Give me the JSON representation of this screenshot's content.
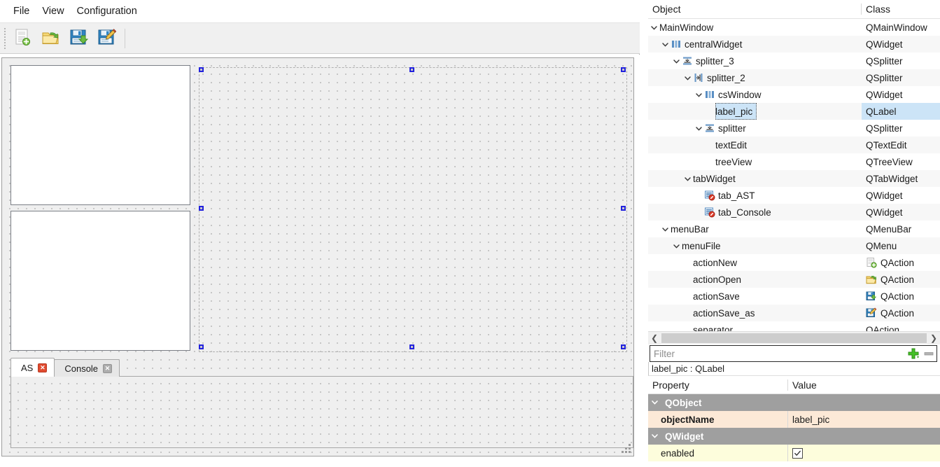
{
  "menubar": {
    "items": [
      {
        "label": "File"
      },
      {
        "label": "View"
      },
      {
        "label": "Configuration"
      }
    ]
  },
  "toolbar": {
    "buttons": [
      {
        "name": "new-file-icon",
        "tooltip": "New"
      },
      {
        "name": "open-folder-icon",
        "tooltip": "Open"
      },
      {
        "name": "save-icon",
        "tooltip": "Save"
      },
      {
        "name": "save-as-icon",
        "tooltip": "Save as"
      }
    ]
  },
  "designer": {
    "tabs": [
      {
        "label": "AS",
        "active": true,
        "close_style": "red"
      },
      {
        "label": "Console",
        "active": false,
        "close_style": "grey"
      }
    ]
  },
  "object_tree": {
    "columns": {
      "object": "Object",
      "class": "Class"
    },
    "rows": [
      {
        "indent": 0,
        "arrow": "down",
        "icon": "none",
        "name": "MainWindow",
        "class": "QMainWindow",
        "class_icon": "none",
        "selected": false
      },
      {
        "indent": 1,
        "arrow": "down",
        "icon": "widget",
        "name": "centralWidget",
        "class": "QWidget",
        "class_icon": "none",
        "selected": false
      },
      {
        "indent": 2,
        "arrow": "down",
        "icon": "vsplit",
        "name": "splitter_3",
        "class": "QSplitter",
        "class_icon": "none",
        "selected": false
      },
      {
        "indent": 3,
        "arrow": "down",
        "icon": "hsplit",
        "name": "splitter_2",
        "class": "QSplitter",
        "class_icon": "none",
        "selected": false
      },
      {
        "indent": 4,
        "arrow": "down",
        "icon": "widget",
        "name": "csWindow",
        "class": "QWidget",
        "class_icon": "none",
        "selected": false
      },
      {
        "indent": 5,
        "arrow": "none",
        "icon": "none",
        "name": "label_pic",
        "class": "QLabel",
        "class_icon": "none",
        "selected": true
      },
      {
        "indent": 4,
        "arrow": "down",
        "icon": "vsplit",
        "name": "splitter",
        "class": "QSplitter",
        "class_icon": "none",
        "selected": false
      },
      {
        "indent": 5,
        "arrow": "none",
        "icon": "none",
        "name": "textEdit",
        "class": "QTextEdit",
        "class_icon": "none",
        "selected": false
      },
      {
        "indent": 5,
        "arrow": "none",
        "icon": "none",
        "name": "treeView",
        "class": "QTreeView",
        "class_icon": "none",
        "selected": false
      },
      {
        "indent": 3,
        "arrow": "down",
        "icon": "none",
        "name": "tabWidget",
        "class": "QTabWidget",
        "class_icon": "none",
        "selected": false
      },
      {
        "indent": 4,
        "arrow": "none",
        "icon": "page-deny",
        "name": "tab_AST",
        "class": "QWidget",
        "class_icon": "none",
        "selected": false
      },
      {
        "indent": 4,
        "arrow": "none",
        "icon": "page-deny",
        "name": "tab_Console",
        "class": "QWidget",
        "class_icon": "none",
        "selected": false
      },
      {
        "indent": 1,
        "arrow": "down",
        "icon": "none",
        "name": "menuBar",
        "class": "QMenuBar",
        "class_icon": "none",
        "selected": false
      },
      {
        "indent": 2,
        "arrow": "down",
        "icon": "none",
        "name": "menuFile",
        "class": "QMenu",
        "class_icon": "none",
        "selected": false
      },
      {
        "indent": 3,
        "arrow": "none",
        "icon": "none",
        "name": "actionNew",
        "class": "QAction",
        "class_icon": "new-file-icon",
        "selected": false
      },
      {
        "indent": 3,
        "arrow": "none",
        "icon": "none",
        "name": "actionOpen",
        "class": "QAction",
        "class_icon": "open-folder-icon",
        "selected": false
      },
      {
        "indent": 3,
        "arrow": "none",
        "icon": "none",
        "name": "actionSave",
        "class": "QAction",
        "class_icon": "save-icon",
        "selected": false
      },
      {
        "indent": 3,
        "arrow": "none",
        "icon": "none",
        "name": "actionSave_as",
        "class": "QAction",
        "class_icon": "save-as-icon",
        "selected": false
      },
      {
        "indent": 3,
        "arrow": "none",
        "icon": "none",
        "name": "separator",
        "class": "QAction",
        "class_icon": "none",
        "selected": false
      }
    ]
  },
  "filter": {
    "placeholder": "Filter",
    "value": "",
    "add_label": "+",
    "remove_label": "‒"
  },
  "selected_object": {
    "summary": "label_pic : QLabel"
  },
  "property_editor": {
    "columns": {
      "property": "Property",
      "value": "Value"
    },
    "rows": [
      {
        "kind": "group",
        "name": "QObject",
        "value": ""
      },
      {
        "kind": "peach",
        "name": "objectName",
        "value": "label_pic"
      },
      {
        "kind": "group",
        "name": "QWidget",
        "value": ""
      },
      {
        "kind": "yellow",
        "name": "enabled",
        "value": "",
        "checkbox": true,
        "checked": true
      }
    ]
  },
  "colors": {
    "selection_blue": "#cce4f7",
    "group_header_grey": "#9f9f9f",
    "peach_row": "#fce9d7",
    "yellow_row": "#fdfddc",
    "handle_blue": "#2222dd",
    "canvas_grey": "#efefef"
  }
}
